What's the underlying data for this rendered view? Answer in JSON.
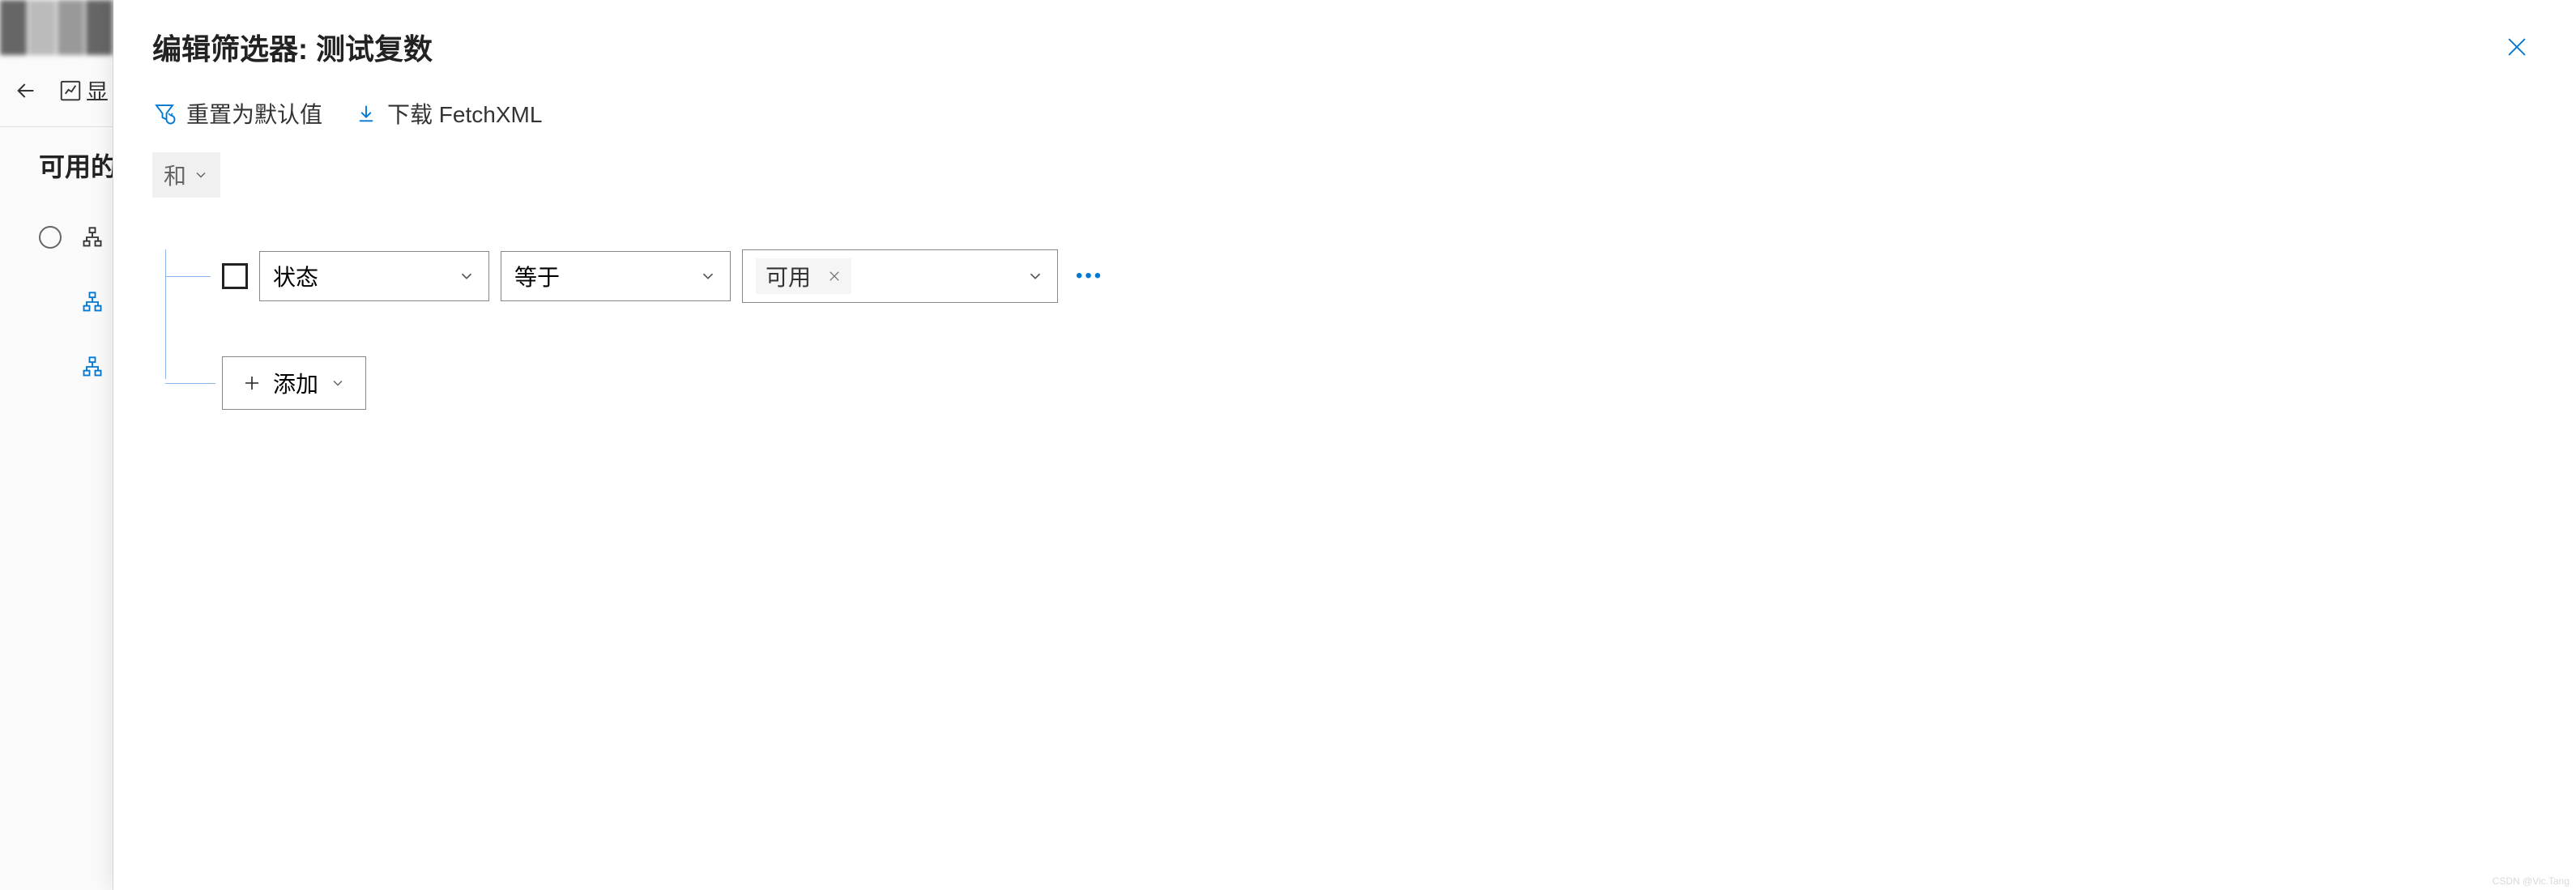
{
  "sidebar": {
    "truncated_title": "可用的",
    "chart_label_truncated": "显"
  },
  "panel": {
    "title": "编辑筛选器: 测试复数"
  },
  "toolbar": {
    "reset_label": "重置为默认值",
    "download_label": "下载 FetchXML"
  },
  "filter": {
    "group_operator": "和",
    "condition": {
      "field": "状态",
      "operator": "等于",
      "value_tag": "可用"
    },
    "add_label": "添加"
  },
  "watermark": "CSDN @Vic.Tang"
}
